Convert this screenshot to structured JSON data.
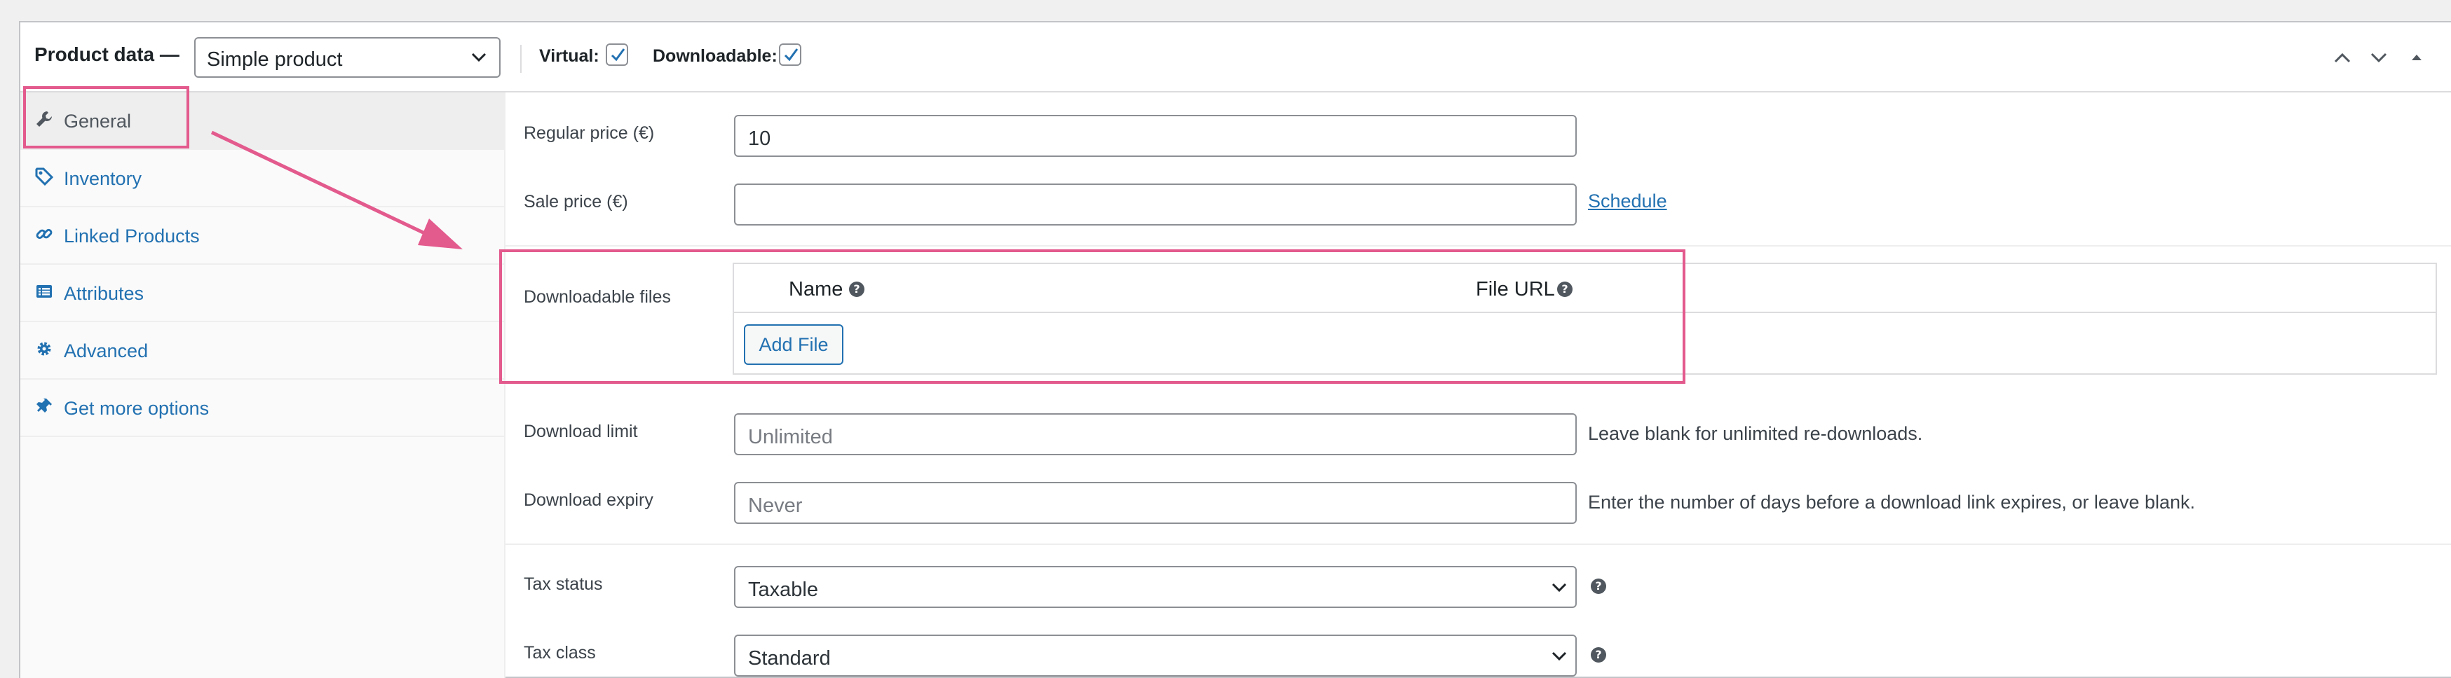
{
  "header": {
    "title": "Product data —",
    "product_type": "Simple product",
    "virtual_label": "Virtual:",
    "virtual_checked": true,
    "downloadable_label": "Downloadable:",
    "downloadable_checked": true
  },
  "sidebar": {
    "items": [
      {
        "label": "General",
        "icon": "wrench-icon",
        "active": true
      },
      {
        "label": "Inventory",
        "icon": "tag-icon",
        "active": false
      },
      {
        "label": "Linked Products",
        "icon": "link-icon",
        "active": false
      },
      {
        "label": "Attributes",
        "icon": "list-icon",
        "active": false
      },
      {
        "label": "Advanced",
        "icon": "gear-icon",
        "active": false
      },
      {
        "label": "Get more options",
        "icon": "plugin-icon",
        "active": false
      }
    ]
  },
  "general": {
    "regular_price_label": "Regular price (€)",
    "regular_price_value": "10",
    "sale_price_label": "Sale price (€)",
    "sale_price_value": "",
    "schedule_link": "Schedule",
    "downloadable_files_label": "Downloadable files",
    "files_table": {
      "col_name": "Name",
      "col_url": "File URL",
      "add_file_button": "Add File"
    },
    "download_limit_label": "Download limit",
    "download_limit_placeholder": "Unlimited",
    "download_limit_desc": "Leave blank for unlimited re-downloads.",
    "download_expiry_label": "Download expiry",
    "download_expiry_placeholder": "Never",
    "download_expiry_desc": "Enter the number of days before a download link expires, or leave blank.",
    "tax_status_label": "Tax status",
    "tax_status_value": "Taxable",
    "tax_class_label": "Tax class",
    "tax_class_value": "Standard"
  },
  "colors": {
    "link": "#2271b1",
    "annotation": "#e35a8d",
    "border": "#8c8f94"
  }
}
